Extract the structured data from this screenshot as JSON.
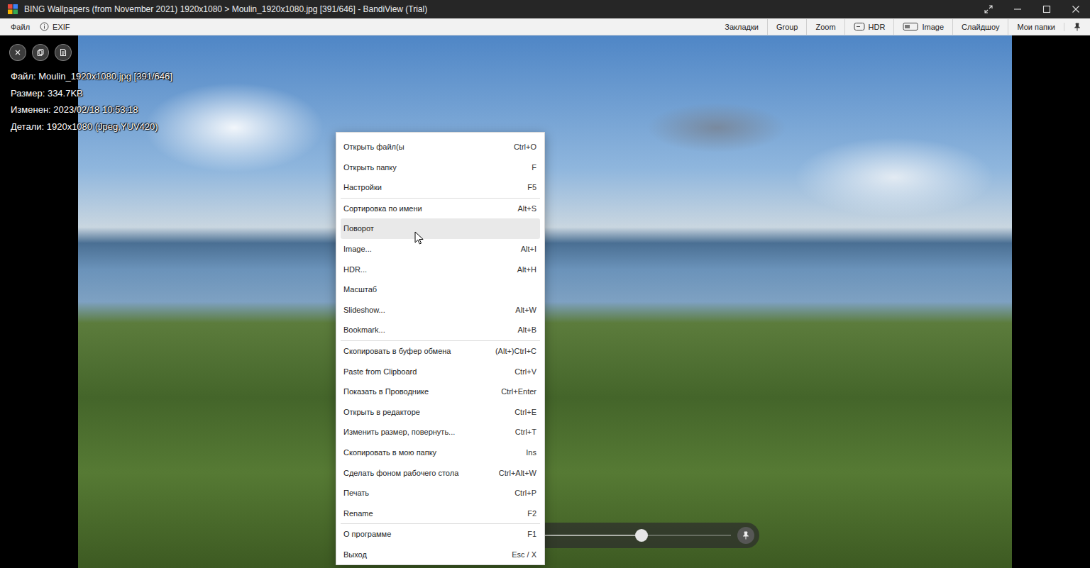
{
  "window": {
    "title": "BING Wallpapers (from November 2021) 1920x1080 > Moulin_1920x1080.jpg [391/646] - BandiView (Trial)"
  },
  "menubar": {
    "left": [
      {
        "label": "Файл",
        "kind": "plain"
      },
      {
        "label": "EXIF",
        "kind": "info"
      }
    ],
    "right": [
      {
        "label": "Закладки",
        "kind": "plain"
      },
      {
        "label": "Group",
        "kind": "plain"
      },
      {
        "label": "Zoom",
        "kind": "plain"
      },
      {
        "label": "HDR",
        "kind": "hdr"
      },
      {
        "label": "Image",
        "kind": "image"
      },
      {
        "label": "Слайдшоу",
        "kind": "plain"
      },
      {
        "label": "Мои папки",
        "kind": "plain"
      }
    ]
  },
  "info_overlay": [
    "Файл: Moulin_1920x1080.jpg [391/646]",
    "Размер: 334.7KB",
    "Изменен: 2023/02/18 10:53:18",
    "Детали: 1920x1080 (Jpeg,YUV420)"
  ],
  "context_menu": {
    "sections": [
      [
        {
          "label": "Открыть файл(ы",
          "shortcut": "Ctrl+O",
          "selected": false
        },
        {
          "label": "Открыть папку",
          "shortcut": "F",
          "selected": false
        },
        {
          "label": "Настройки",
          "shortcut": "F5",
          "selected": false
        }
      ],
      [
        {
          "label": "Сортировка по имени",
          "shortcut": "Alt+S",
          "selected": false
        },
        {
          "label": "Поворот",
          "selected": true
        },
        {
          "label": "Image...",
          "shortcut": "Alt+I",
          "selected": false
        },
        {
          "label": "HDR...",
          "shortcut": "Alt+H",
          "selected": false
        },
        {
          "label": "Масштаб",
          "selected": false
        },
        {
          "label": "Slideshow...",
          "shortcut": "Alt+W",
          "selected": false
        },
        {
          "label": "Bookmark...",
          "shortcut": "Alt+B",
          "selected": false
        }
      ],
      [
        {
          "label": "Скопировать в буфер обмена",
          "shortcut": "(Alt+)Ctrl+C",
          "selected": false
        },
        {
          "label": "Paste from Clipboard",
          "shortcut": "Ctrl+V",
          "selected": false
        },
        {
          "label": "Показать в Проводнике",
          "shortcut": "Ctrl+Enter",
          "selected": false
        },
        {
          "label": "Открыть в редакторе",
          "shortcut": "Ctrl+E",
          "selected": false
        },
        {
          "label": "Изменить размер, повернуть...",
          "shortcut": "Ctrl+T",
          "selected": false
        },
        {
          "label": "Скопировать в мою папку",
          "shortcut": "Ins",
          "selected": false
        },
        {
          "label": "Сделать фоном рабочего стола",
          "shortcut": "Ctrl+Alt+W",
          "selected": false
        },
        {
          "label": "Печать",
          "shortcut": "Ctrl+P",
          "selected": false
        },
        {
          "label": "Rename",
          "shortcut": "F2",
          "selected": false
        }
      ],
      [
        {
          "label": "О программе",
          "shortcut": "F1",
          "selected": false
        },
        {
          "label": "Выход",
          "shortcut": "Esc / X",
          "selected": false
        }
      ]
    ]
  },
  "navigator": {
    "level": 0.72
  }
}
